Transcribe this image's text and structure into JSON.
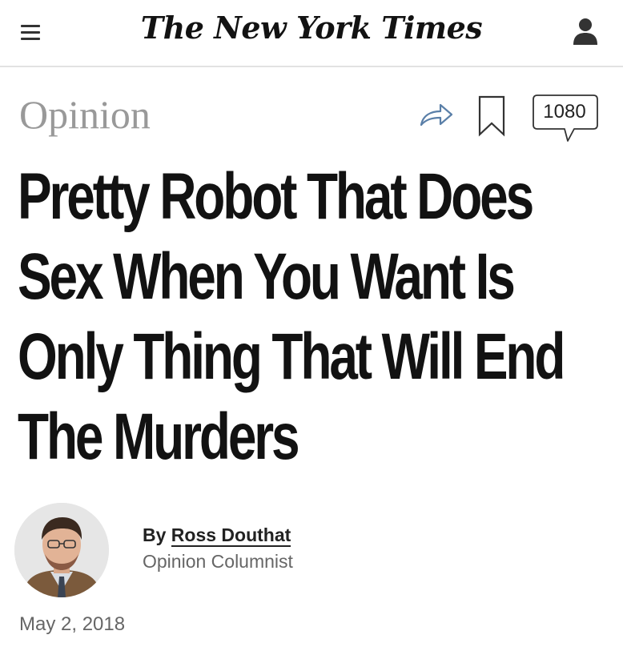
{
  "header": {
    "masthead": "The New York Times",
    "menu_icon": "hamburger-menu-icon",
    "account_icon": "user-icon"
  },
  "article": {
    "section": "Opinion",
    "actions": {
      "share_icon": "share-arrow-icon",
      "bookmark_icon": "bookmark-icon",
      "comment_icon": "comment-bubble-icon",
      "comment_count": "1080"
    },
    "headline": "Pretty Robot That Does Sex When You Want Is Only Thing That Will End The Murders",
    "byline": {
      "prefix": "By ",
      "author": "Ross Douthat",
      "role": "Opinion Columnist"
    },
    "date": "May 2, 2018"
  },
  "colors": {
    "text": "#121212",
    "section_gray": "#999999",
    "meta_gray": "#666666",
    "share_blue": "#5a7fa8",
    "divider": "#e2e2e2"
  }
}
